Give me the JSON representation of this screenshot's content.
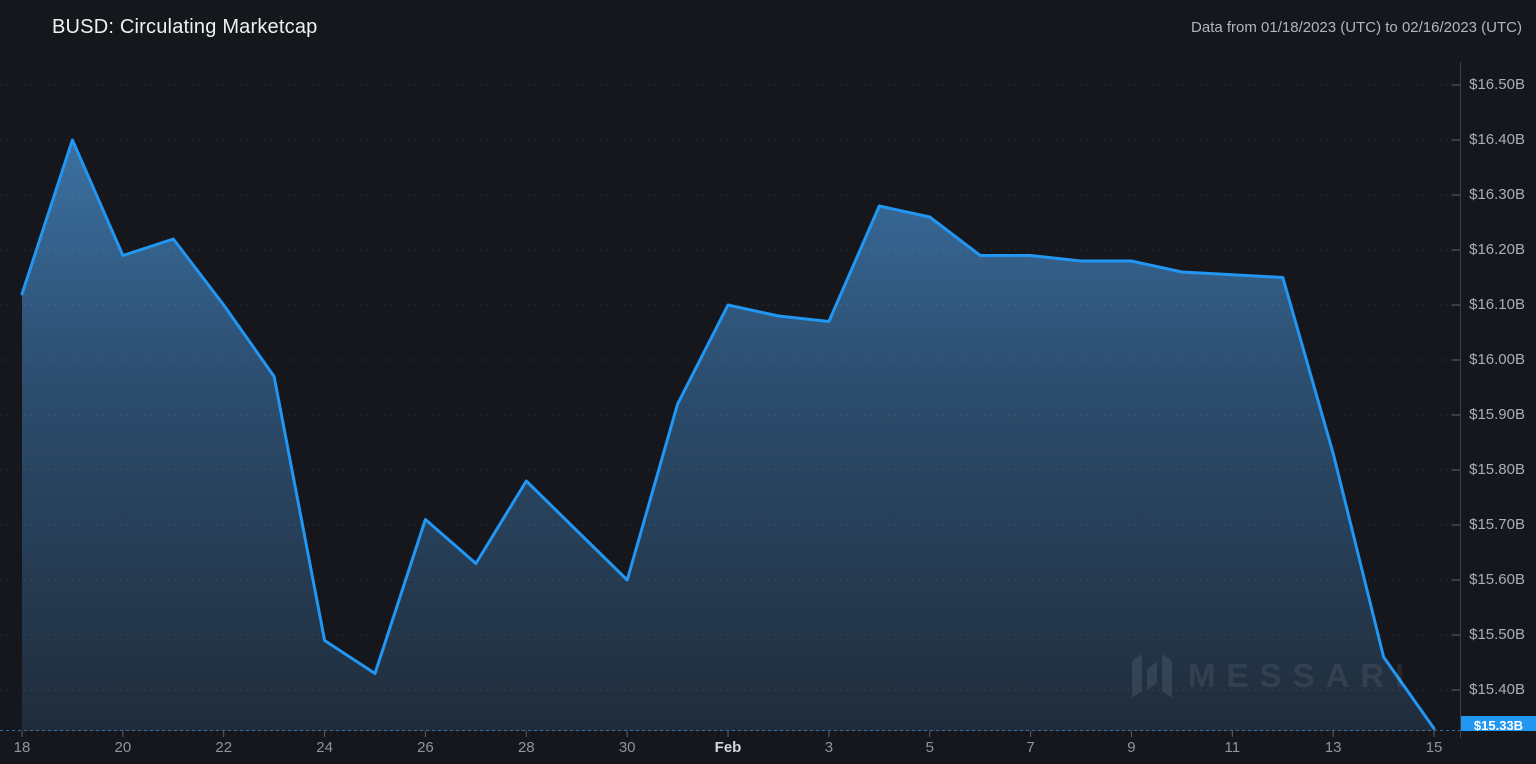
{
  "header": {
    "title": "BUSD: Circulating Marketcap",
    "date_range": "Data from 01/18/2023 (UTC) to 02/16/2023 (UTC)"
  },
  "watermark": {
    "brand": "MESSARI"
  },
  "colors": {
    "accent": "#2196f3",
    "background": "#15171c",
    "area_top": "#3f78ad",
    "area_mid": "#2c4e70",
    "area_bottom": "#202c3a",
    "grid": "rgba(255,255,255,0.07)",
    "axis_line": "#3b4148",
    "tick": "#5a616a",
    "current_value_line": "#3c7fbd"
  },
  "chart_data": {
    "type": "area",
    "title": "BUSD: Circulating Marketcap",
    "subtitle": "Data from 01/18/2023 (UTC) to 02/16/2023 (UTC)",
    "xlabel": "",
    "ylabel": "",
    "unit": "USD billions",
    "x": [
      "01/18",
      "01/19",
      "01/20",
      "01/21",
      "01/22",
      "01/23",
      "01/24",
      "01/25",
      "01/26",
      "01/27",
      "01/28",
      "01/29",
      "01/30",
      "01/31",
      "02/01",
      "02/02",
      "02/03",
      "02/04",
      "02/05",
      "02/06",
      "02/07",
      "02/08",
      "02/09",
      "02/10",
      "02/11",
      "02/12",
      "02/13",
      "02/14",
      "02/15"
    ],
    "values": [
      16.12,
      16.4,
      16.19,
      16.22,
      16.1,
      15.97,
      15.49,
      15.43,
      15.71,
      15.63,
      15.78,
      15.69,
      15.6,
      15.92,
      16.1,
      16.08,
      16.07,
      16.28,
      16.26,
      16.19,
      16.19,
      16.18,
      16.18,
      16.16,
      16.155,
      16.15,
      15.83,
      15.46,
      15.33
    ],
    "ylim": [
      15.325,
      16.545
    ],
    "grid": true,
    "legend": false,
    "legend_position": "none",
    "y_axis_side": "right",
    "y_ticks": [
      {
        "label": "$16.50B",
        "value": 16.5
      },
      {
        "label": "$16.40B",
        "value": 16.4
      },
      {
        "label": "$16.30B",
        "value": 16.3
      },
      {
        "label": "$16.20B",
        "value": 16.2
      },
      {
        "label": "$16.10B",
        "value": 16.1
      },
      {
        "label": "$16.00B",
        "value": 16.0
      },
      {
        "label": "$15.90B",
        "value": 15.9
      },
      {
        "label": "$15.80B",
        "value": 15.8
      },
      {
        "label": "$15.70B",
        "value": 15.7
      },
      {
        "label": "$15.60B",
        "value": 15.6
      },
      {
        "label": "$15.50B",
        "value": 15.5
      },
      {
        "label": "$15.40B",
        "value": 15.4
      }
    ],
    "x_ticks": [
      {
        "label": "18",
        "index": 0
      },
      {
        "label": "20",
        "index": 2
      },
      {
        "label": "22",
        "index": 4
      },
      {
        "label": "24",
        "index": 6
      },
      {
        "label": "26",
        "index": 8
      },
      {
        "label": "28",
        "index": 10
      },
      {
        "label": "30",
        "index": 12
      },
      {
        "label": "Feb",
        "index": 14
      },
      {
        "label": "3",
        "index": 16
      },
      {
        "label": "5",
        "index": 18
      },
      {
        "label": "7",
        "index": 20
      },
      {
        "label": "9",
        "index": 22
      },
      {
        "label": "11",
        "index": 24
      },
      {
        "label": "13",
        "index": 26
      },
      {
        "label": "15",
        "index": 28
      }
    ],
    "last_value_label": "$15.33B"
  }
}
